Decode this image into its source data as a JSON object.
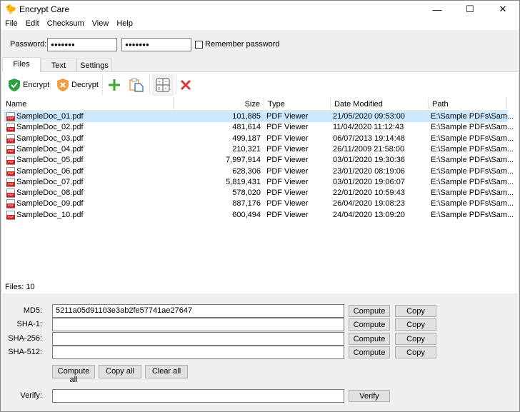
{
  "window": {
    "title": "Encrypt Care",
    "minimize": "—",
    "maximize": "☐",
    "close": "✕"
  },
  "menu": [
    "File",
    "Edit",
    "Checksum",
    "View",
    "Help"
  ],
  "password": {
    "label": "Password:",
    "value1": "●●●●●●●",
    "value2": "●●●●●●●",
    "remember_label": "Remember password",
    "remember_checked": false
  },
  "tabs": [
    "Files",
    "Text",
    "Settings"
  ],
  "toolbar": {
    "encrypt": "Encrypt",
    "decrypt": "Decrypt"
  },
  "columns": [
    "Name",
    "Size",
    "Type",
    "Date Modified",
    "Path"
  ],
  "files": [
    [
      "SampleDoc_01.pdf",
      "101,885",
      "PDF Viewer",
      "21/05/2020 09:53:00",
      "E:\\Sample PDFs\\Sam..."
    ],
    [
      "SampleDoc_02.pdf",
      "481,614",
      "PDF Viewer",
      "11/04/2020 11:12:43",
      "E:\\Sample PDFs\\Sam..."
    ],
    [
      "SampleDoc_03.pdf",
      "499,187",
      "PDF Viewer",
      "06/07/2013 19:14:48",
      "E:\\Sample PDFs\\Sam..."
    ],
    [
      "SampleDoc_04.pdf",
      "210,321",
      "PDF Viewer",
      "26/11/2009 21:58:00",
      "E:\\Sample PDFs\\Sam..."
    ],
    [
      "SampleDoc_05.pdf",
      "7,997,914",
      "PDF Viewer",
      "03/01/2020 19:30:36",
      "E:\\Sample PDFs\\Sam..."
    ],
    [
      "SampleDoc_06.pdf",
      "628,306",
      "PDF Viewer",
      "23/01/2020 08:19:06",
      "E:\\Sample PDFs\\Sam..."
    ],
    [
      "SampleDoc_07.pdf",
      "5,819,431",
      "PDF Viewer",
      "03/01/2020 19:06:07",
      "E:\\Sample PDFs\\Sam..."
    ],
    [
      "SampleDoc_08.pdf",
      "578,020",
      "PDF Viewer",
      "22/01/2020 10:59:43",
      "E:\\Sample PDFs\\Sam..."
    ],
    [
      "SampleDoc_09.pdf",
      "887,176",
      "PDF Viewer",
      "26/04/2020 19:08:23",
      "E:\\Sample PDFs\\Sam..."
    ],
    [
      "SampleDoc_10.pdf",
      "600,494",
      "PDF Viewer",
      "24/04/2020 13:09:20",
      "E:\\Sample PDFs\\Sam..."
    ]
  ],
  "status": "Files: 10",
  "hashes": [
    {
      "label": "MD5:",
      "value": "5211a05d91103e3ab2fe57741ae27647"
    },
    {
      "label": "SHA-1:",
      "value": ""
    },
    {
      "label": "SHA-256:",
      "value": ""
    },
    {
      "label": "SHA-512:",
      "value": ""
    }
  ],
  "buttons": {
    "compute": "Compute",
    "copy": "Copy",
    "compute_all": "Compute all",
    "copy_all": "Copy all",
    "clear_all": "Clear all",
    "verify": "Verify"
  },
  "verify": {
    "label": "Verify:",
    "value": ""
  }
}
